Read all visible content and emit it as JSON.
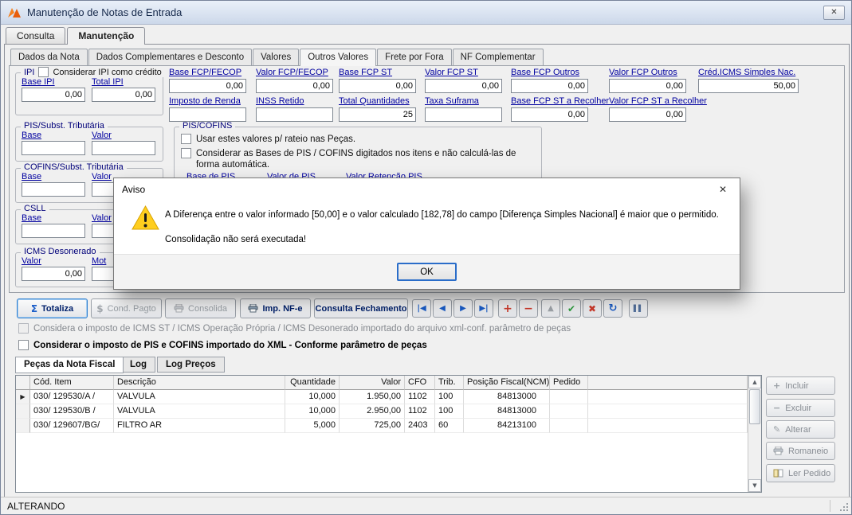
{
  "window": {
    "title": "Manutenção de Notas de Entrada",
    "status": "ALTERANDO"
  },
  "icons": {
    "close": "✕",
    "dialog_close": "✕",
    "sigma": "Σ",
    "dollar": "$",
    "nav_first": "|◀",
    "nav_prior": "◀",
    "nav_next": "▶",
    "nav_last": "▶|",
    "insert": "+",
    "delete": "−",
    "up": "▲",
    "post": "✔",
    "cancel": "✖",
    "refresh": "↻",
    "pause": "▌▌",
    "row_marker": "▶",
    "scroll_up": "▲",
    "scroll_down": "▼",
    "add": "+",
    "remove": "−",
    "edit": "✎"
  },
  "tabs": {
    "main": [
      {
        "label": "Consulta"
      },
      {
        "label": "Manutenção"
      }
    ],
    "inner": [
      {
        "label": "Dados da Nota"
      },
      {
        "label": "Dados Complementares e Desconto"
      },
      {
        "label": "Valores"
      },
      {
        "label": "Outros Valores"
      },
      {
        "label": "Frete por Fora"
      },
      {
        "label": "NF Complementar"
      }
    ],
    "bottom": [
      {
        "label": "Peças da Nota Fiscal"
      },
      {
        "label": "Log"
      },
      {
        "label": "Log Preços"
      }
    ]
  },
  "form": {
    "ipi": {
      "title": "IPI",
      "checkbox_label": "Considerar IPI como crédito",
      "base_label": "Base IPI",
      "base_value": "0,00",
      "total_label": "Total IPI",
      "total_value": "0,00"
    },
    "pis_subst": {
      "title": "PIS/Subst. Tributária",
      "base_label": "Base",
      "base_value": "",
      "valor_label": "Valor",
      "valor_value": ""
    },
    "cofins_subst": {
      "title": "COFINS/Subst. Tributária",
      "base_label": "Base",
      "base_value": "",
      "valor_label": "Valor",
      "valor_value": ""
    },
    "csll": {
      "title": "CSLL",
      "base_label": "Base",
      "base_value": "",
      "valor_label": "Valor",
      "valor_value": ""
    },
    "icms_desonerado": {
      "title": "ICMS Desonerado",
      "valor_label": "Valor",
      "valor_value": "0,00",
      "mot_label": "Mot",
      "mot_value": ""
    },
    "pis_cofins": {
      "title": "PIS/COFINS",
      "check1": "Usar estes valores p/ rateio nas Peças.",
      "check2": "Considerar as Bases de PIS / COFINS digitados nos itens e não calculá-las de forma automática.",
      "labels": [
        "Base de PIS",
        "Valor de PIS",
        "Valor Retenção PIS"
      ]
    },
    "row1": [
      {
        "label": "Base FCP/FECOP",
        "value": "0,00"
      },
      {
        "label": "Valor FCP/FECOP",
        "value": "0,00"
      },
      {
        "label": "Base FCP ST",
        "value": "0,00"
      },
      {
        "label": "Valor FCP ST",
        "value": "0,00"
      },
      {
        "label": "Base FCP Outros",
        "value": "0,00"
      },
      {
        "label": "Valor FCP Outros",
        "value": "0,00"
      },
      {
        "label": "Créd.ICMS Simples Nac.",
        "value": "50,00"
      }
    ],
    "row2": [
      {
        "label": "Imposto de Renda",
        "value": ""
      },
      {
        "label": "INSS Retido",
        "value": ""
      },
      {
        "label": "Total Quantidades",
        "value": "25"
      },
      {
        "label": "Taxa Suframa",
        "value": ""
      },
      {
        "label": "Base FCP ST a Recolher",
        "value": "0,00"
      },
      {
        "label": "Valor FCP ST a Recolher",
        "value": "0,00"
      }
    ]
  },
  "toolbar": {
    "totaliza": "Totaliza",
    "cond_pagto": "Cond. Pagto",
    "consolida": "Consolida",
    "imp_nfe": "Imp. NF-e",
    "consulta_fechamento": "Consulta Fechamento"
  },
  "checks": {
    "icms_xml": "Considera o imposto de ICMS ST / ICMS Operação Própria / ICMS Desonerado importado do arquivo xml-conf. parâmetro de peças",
    "pis_cofins_xml": "Considerar o imposto de PIS e COFINS importado do XML - Conforme parâmetro de peças"
  },
  "grid": {
    "columns": [
      "Cód. Item",
      "Descrição",
      "Quantidade",
      "Valor",
      "CFO",
      "Trib.",
      "Posição Fiscal(NCM)",
      "Pedido"
    ],
    "rows": [
      [
        "030/ 129530/A /",
        "VALVULA",
        "10,000",
        "1.950,00",
        "1102",
        "100",
        "84813000",
        ""
      ],
      [
        "030/ 129530/B /",
        "VALVULA",
        "10,000",
        "2.950,00",
        "1102",
        "100",
        "84813000",
        ""
      ],
      [
        "030/ 129607/BG/",
        "FILTRO AR",
        "5,000",
        "725,00",
        "2403",
        "60",
        "84213100",
        ""
      ]
    ]
  },
  "side_buttons": [
    {
      "label": "Incluir"
    },
    {
      "label": "Excluir"
    },
    {
      "label": "Alterar"
    },
    {
      "label": "Romaneio"
    },
    {
      "label": "Ler Pedido"
    }
  ],
  "dialog": {
    "title": "Aviso",
    "message_line1": "A Diferença entre o valor informado [50,00] e o valor calculado [182,78] do campo [Diferença Simples Nacional] é maior que o permitido.",
    "message_line2": "Consolidação não será executada!",
    "ok_label": "OK"
  }
}
